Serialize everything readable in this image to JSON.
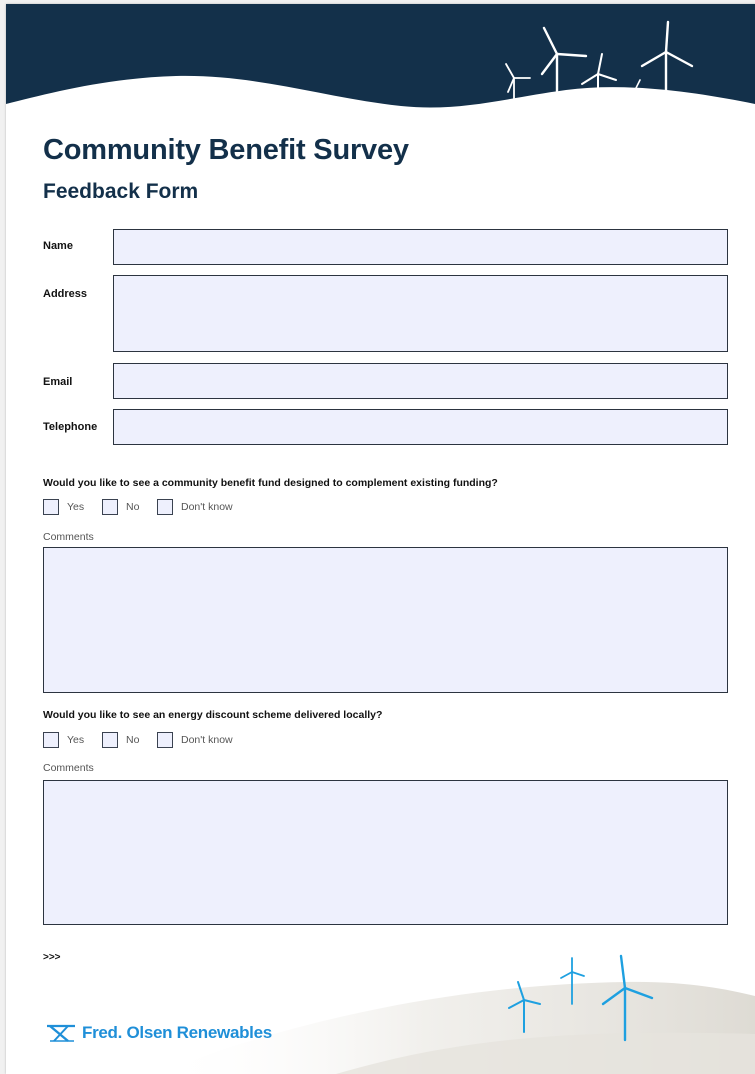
{
  "header": {
    "title": "Community Benefit Survey",
    "subtitle": "Feedback Form"
  },
  "fields": {
    "name_label": "Name",
    "address_label": "Address",
    "email_label": "Email",
    "telephone_label": "Telephone",
    "name_value": "",
    "address_value": "",
    "email_value": "",
    "telephone_value": ""
  },
  "questions": [
    {
      "text": "Would you like to see a community benefit fund designed to complement existing funding?",
      "options": [
        "Yes",
        "No",
        "Don't know"
      ],
      "comments_label": "Comments",
      "comments_value": ""
    },
    {
      "text": "Would you like to see an energy discount scheme delivered locally?",
      "options": [
        "Yes",
        "No",
        "Don't know"
      ],
      "comments_label": "Comments",
      "comments_value": ""
    }
  ],
  "continue_marker": ">>>",
  "brand": {
    "name": "Fred. Olsen Renewables",
    "icon": "fred-olsen-logo-icon",
    "color": "#1f8fd8"
  },
  "colors": {
    "navy": "#13304a",
    "field_fill": "#eef0fd",
    "turbine_blue": "#1ea0e0"
  }
}
